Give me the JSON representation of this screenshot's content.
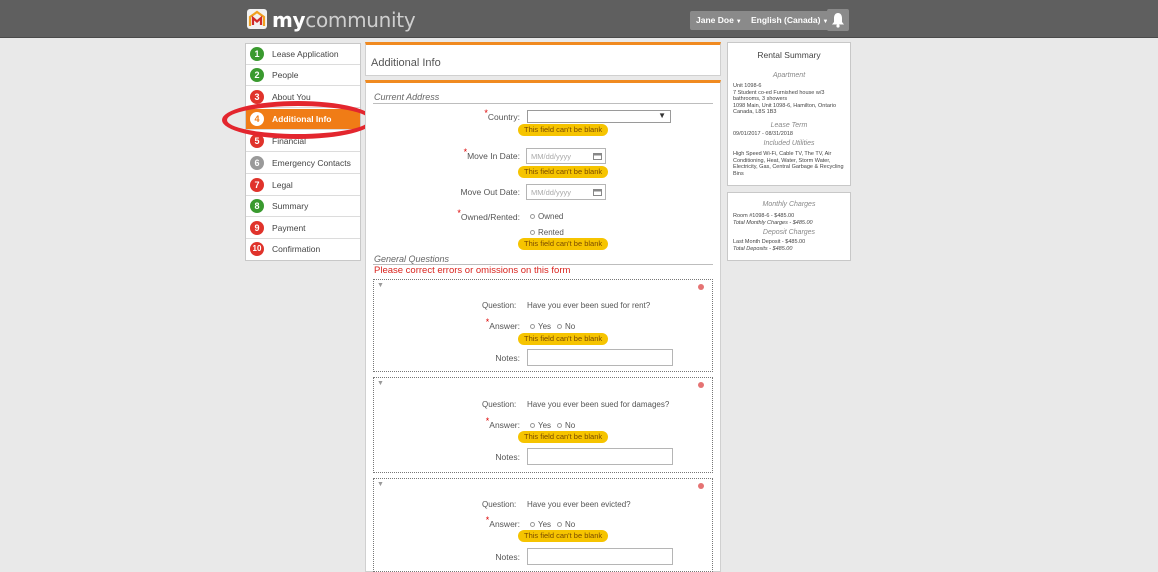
{
  "topbar": {
    "logo_bold": "my",
    "logo_light": "community",
    "user_label": "Jane Doe",
    "language_label": "English (Canada)",
    "bell_icon": "bell-icon"
  },
  "sidebar": {
    "items": [
      {
        "num": "1",
        "label": "Lease Application",
        "color": "#3a9a2f"
      },
      {
        "num": "2",
        "label": "People",
        "color": "#3a9a2f"
      },
      {
        "num": "3",
        "label": "About You",
        "color": "#e0332b"
      },
      {
        "num": "4",
        "label": "Additional Info",
        "color": "#f07c16"
      },
      {
        "num": "5",
        "label": "Financial",
        "color": "#e0332b"
      },
      {
        "num": "6",
        "label": "Emergency Contacts",
        "color": "#9a9a9a"
      },
      {
        "num": "7",
        "label": "Legal",
        "color": "#e0332b"
      },
      {
        "num": "8",
        "label": "Summary",
        "color": "#3a9a2f"
      },
      {
        "num": "9",
        "label": "Payment",
        "color": "#e0332b"
      },
      {
        "num": "10",
        "label": "Confirmation",
        "color": "#e0332b"
      }
    ]
  },
  "main": {
    "title": "Additional Info",
    "current_address": {
      "heading": "Current Address",
      "country_label": "Country:",
      "move_in_label": "Move In Date:",
      "move_out_label": "Move Out Date:",
      "date_placeholder": "MM/dd/yyyy",
      "owned_rented_label": "Owned/Rented:",
      "owned_option": "Owned",
      "rented_option": "Rented"
    },
    "error_blank": "This field can't be blank",
    "general_questions": {
      "heading": "General Questions",
      "error_banner": "Please correct errors or omissions on this form",
      "question_label": "Question:",
      "answer_label": "Answer:",
      "notes_label": "Notes:",
      "yes": "Yes",
      "no": "No",
      "questions": [
        "Have you ever been sued for rent?",
        "Have you ever been sued for damages?",
        "Have you ever been evicted?"
      ]
    }
  },
  "rental_summary": {
    "title": "Rental Summary",
    "apartment_heading": "Apartment",
    "apartment_text": "Unit 1098-6\n7 Student co-ed Furnished house w/3 bathrooms, 3 showers\n1098 Main, Unit 1098-6, Hamilton, Ontario Canada, L8S 1B3",
    "lease_term_heading": "Lease Term",
    "lease_term": "09/01/2017 - 08/31/2018",
    "utilities_heading": "Included Utilities",
    "utilities": "High Speed Wi-Fi, Cable TV, The TV, Air Conditioning, Heat, Water, Storm Water, Electricity, Gas, Central Garbage & Recycling Bins"
  },
  "charges": {
    "monthly_heading": "Monthly Charges",
    "monthly_line": "Room #1098-6 - $485.00",
    "monthly_total": "Total Monthly Charges - $485.00",
    "deposit_heading": "Deposit Charges",
    "deposit_line": "Last Month Deposit - $485.00",
    "deposit_total": "Total Deposits - $485.00"
  },
  "colors": {
    "accent_orange": "#f07c16",
    "error_yellow": "#f6c400",
    "error_red": "#d9241e",
    "topbar": "#5f5f5f"
  }
}
